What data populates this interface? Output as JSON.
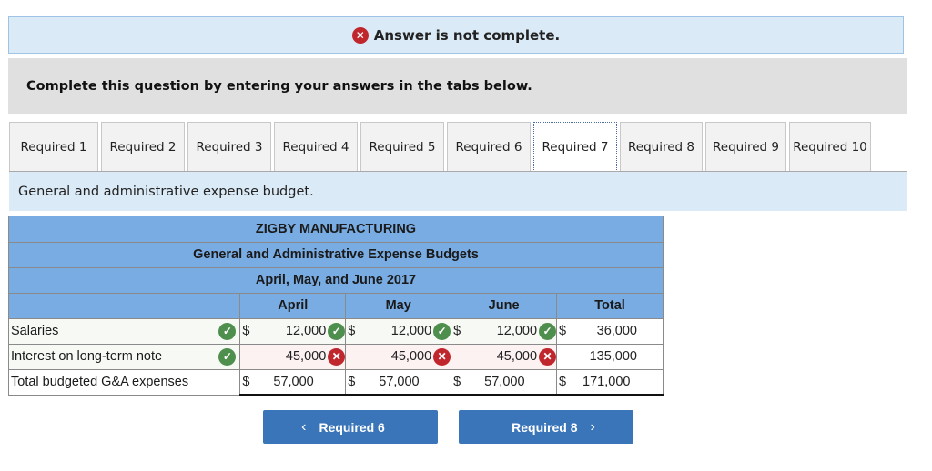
{
  "status": {
    "icon": "x-circle-icon",
    "message": "Answer is not complete."
  },
  "instruction": "Complete this question by entering your answers in the tabs below.",
  "tabs": [
    {
      "label": "Required 1"
    },
    {
      "label": "Required 2"
    },
    {
      "label": "Required 3"
    },
    {
      "label": "Required 4"
    },
    {
      "label": "Required 5"
    },
    {
      "label": "Required 6"
    },
    {
      "label": "Required 7",
      "active": true
    },
    {
      "label": "Required 8"
    },
    {
      "label": "Required 9"
    },
    {
      "label": "Required 10"
    }
  ],
  "description": "General and administrative expense budget.",
  "table": {
    "company": "ZIGBY MANUFACTURING",
    "title": "General and Administrative Expense Budgets",
    "period": "April, May, and June 2017",
    "columns": [
      "April",
      "May",
      "June",
      "Total"
    ],
    "currency": "$",
    "rows": [
      {
        "label": "Salaries",
        "label_status": "correct",
        "values": [
          "12,000",
          "12,000",
          "12,000",
          "36,000"
        ],
        "status": [
          "correct",
          "correct",
          "correct",
          null
        ]
      },
      {
        "label": "Interest on long-term note",
        "label_status": "correct",
        "values": [
          "45,000",
          "45,000",
          "45,000",
          "135,000"
        ],
        "status": [
          "incorrect",
          "incorrect",
          "incorrect",
          null
        ]
      },
      {
        "label": "Total budgeted G&A expenses",
        "values": [
          "57,000",
          "57,000",
          "57,000",
          "171,000"
        ]
      }
    ]
  },
  "nav": {
    "prev_label": "Required 6",
    "next_label": "Required 8",
    "prev_icon": "chevron-left-icon",
    "next_icon": "chevron-right-icon"
  }
}
